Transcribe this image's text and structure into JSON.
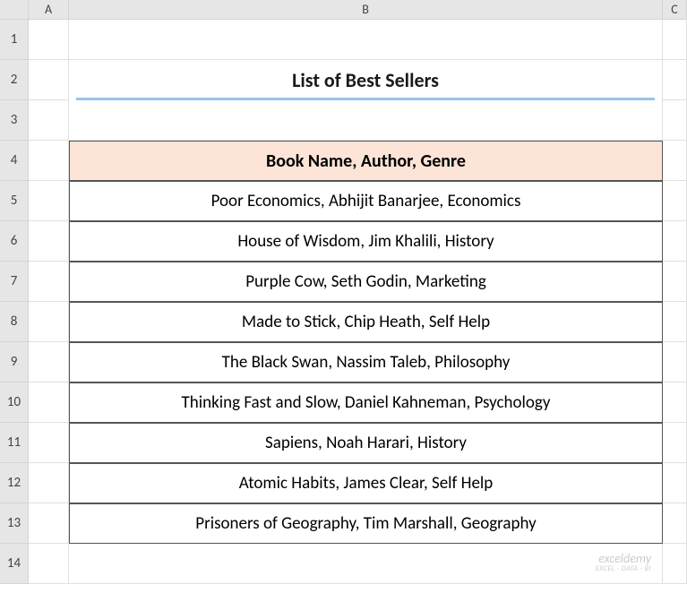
{
  "columns": [
    "",
    "A",
    "B",
    "C"
  ],
  "rows": [
    "1",
    "2",
    "3",
    "4",
    "5",
    "6",
    "7",
    "8",
    "9",
    "10",
    "11",
    "12",
    "13",
    "14"
  ],
  "title": "List of Best Sellers",
  "table_header": "Book Name, Author, Genre",
  "data": [
    "Poor Economics, Abhijit Banarjee, Economics",
    "House of Wisdom, Jim Khalili, History",
    "Purple Cow, Seth Godin, Marketing",
    "Made to Stick, Chip Heath, Self Help",
    "The Black Swan, Nassim Taleb, Philosophy",
    "Thinking Fast and Slow, Daniel Kahneman, Psychology",
    "Sapiens, Noah Harari, History",
    "Atomic Habits, James Clear, Self Help",
    "Prisoners of Geography, Tim Marshall, Geography"
  ],
  "watermark": {
    "main": "exceldemy",
    "sub": "EXCEL · DATA · BI"
  }
}
